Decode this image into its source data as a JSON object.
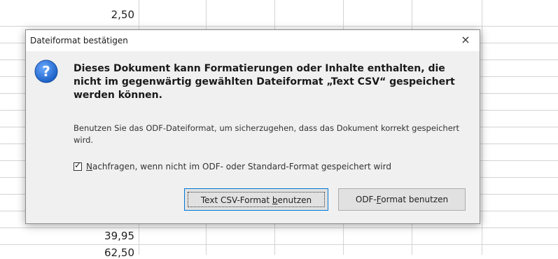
{
  "sheet": {
    "top_value": "2,50",
    "bottom_value": "39,95",
    "partial_value": "62,50"
  },
  "dialog": {
    "title": "Dateiformat bestätigen",
    "close_label": "×",
    "icon": "question-icon",
    "main_message": "Dieses Dokument kann Formatierungen oder Inhalte enthalten, die nicht im gegenwärtig gewählten Dateiformat „Text CSV“ gespeichert werden können.",
    "sub_message": "Benutzen Sie das ODF-Dateiformat, um sicherzugehen, dass das Dokument korrekt gespeichert wird.",
    "checkbox": {
      "checked": true,
      "mnemonic": "N",
      "label_rest": "achfragen, wenn nicht im ODF- oder Standard-Format gespeichert wird"
    },
    "buttons": {
      "keep_csv": {
        "pre": "Text CSV-Format ",
        "mnemonic": "b",
        "post": "enutzen"
      },
      "use_odf": {
        "pre": "ODF-",
        "mnemonic": "F",
        "post": "ormat benutzen"
      }
    }
  }
}
